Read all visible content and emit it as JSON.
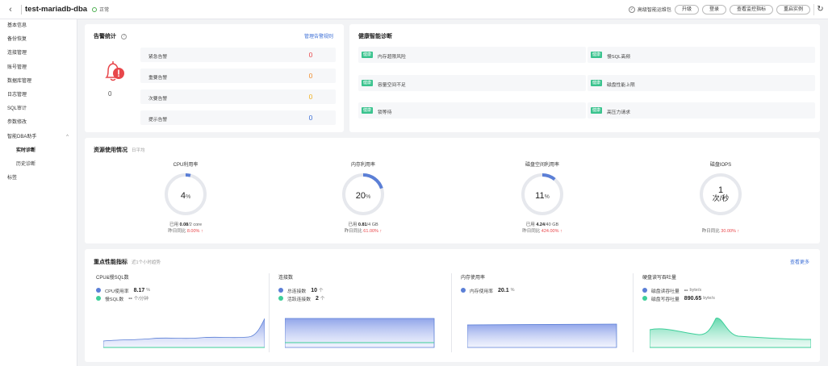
{
  "header": {
    "title": "test-mariadb-dba",
    "status": "正常",
    "toggle_label": "高级智能运维包",
    "buttons": [
      "升级",
      "登录",
      "查看监控指标",
      "重启实例"
    ]
  },
  "sidebar": {
    "items": [
      {
        "label": "基本信息"
      },
      {
        "label": "备份恢复"
      },
      {
        "label": "连接管理"
      },
      {
        "label": "账号管理"
      },
      {
        "label": "数据库管理"
      },
      {
        "label": "日志管理"
      },
      {
        "label": "SQL审计"
      },
      {
        "label": "参数修改"
      },
      {
        "label": "智能DBA助手",
        "expanded": true
      },
      {
        "label": "实时诊断",
        "sub": true,
        "active": true
      },
      {
        "label": "历史诊断",
        "sub": true
      },
      {
        "label": "标签"
      }
    ]
  },
  "alarm": {
    "title": "告警统计",
    "link": "管理告警规则",
    "total": "0",
    "rows": [
      {
        "label": "紧急告警",
        "value": "0",
        "color": "#e8474b"
      },
      {
        "label": "重要告警",
        "value": "0",
        "color": "#f08c2c"
      },
      {
        "label": "次要告警",
        "value": "0",
        "color": "#f0b020"
      },
      {
        "label": "提示告警",
        "value": "0",
        "color": "#3d6fd6"
      }
    ]
  },
  "health": {
    "title": "健康智能诊断",
    "tag": "健康",
    "items": [
      "内存超限风险",
      "慢SQL高频",
      "容量空间不足",
      "磁盘性能上限",
      "锁等待",
      "高压力请求"
    ]
  },
  "resource": {
    "title": "资源使用情况",
    "subtitle": "日平均",
    "gauges": [
      {
        "title": "CPU利用率",
        "value": "4",
        "unit": "%",
        "fraction": 0.04,
        "used_label": "已用",
        "used": "0.08",
        "total": "/2 core",
        "cmp_label": "昨日同比",
        "cmp": "8.00%"
      },
      {
        "title": "内存利用率",
        "value": "20",
        "unit": "%",
        "fraction": 0.2,
        "used_label": "已用",
        "used": "0.81",
        "total": "/4 GB",
        "cmp_label": "昨日同比",
        "cmp": "61.00%"
      },
      {
        "title": "磁盘空间利用率",
        "value": "11",
        "unit": "%",
        "fraction": 0.11,
        "used_label": "已用",
        "used": "4.24",
        "total": "/40 GB",
        "cmp_label": "昨日同比",
        "cmp": "424.00%"
      },
      {
        "title": "磁盘IOPS",
        "value": "1",
        "unit": "次/秒",
        "fraction": 0,
        "used_label": "",
        "used": "",
        "total": "",
        "cmp_label": "昨日同比",
        "cmp": "30.00%"
      }
    ],
    "arrow": "↑"
  },
  "perf": {
    "title": "重点性能指标",
    "subtitle": "近1个小时趋势",
    "link": "查看更多",
    "panels": [
      {
        "title": "CPU&慢SQL数",
        "legends": [
          {
            "label": "CPU使用率",
            "value": "8.17",
            "unit": "%",
            "color": "#5b7fd6"
          },
          {
            "label": "慢SQL数",
            "value": "--",
            "unit": "个/分钟",
            "color": "#3ecf9a"
          }
        ]
      },
      {
        "title": "连接数",
        "legends": [
          {
            "label": "总连接数",
            "value": "10",
            "unit": "个",
            "color": "#5b7fd6"
          },
          {
            "label": "活跃连接数",
            "value": "2",
            "unit": "个",
            "color": "#3ecf9a"
          }
        ]
      },
      {
        "title": "内存使用率",
        "legends": [
          {
            "label": "内存使用率",
            "value": "20.1",
            "unit": "%",
            "color": "#5b7fd6"
          }
        ]
      },
      {
        "title": "硬盘读写吞吐量",
        "legends": [
          {
            "label": "磁盘读吞吐量",
            "value": "--",
            "unit": "byte/s",
            "color": "#5b7fd6"
          },
          {
            "label": "磁盘写吞吐量",
            "value": "890.65",
            "unit": "byte/s",
            "color": "#3ecf9a"
          }
        ]
      }
    ]
  },
  "icons": {
    "back": "chevron-left-icon",
    "refresh": "refresh-icon",
    "bell": "bell-alert-icon",
    "help": "question-icon"
  }
}
